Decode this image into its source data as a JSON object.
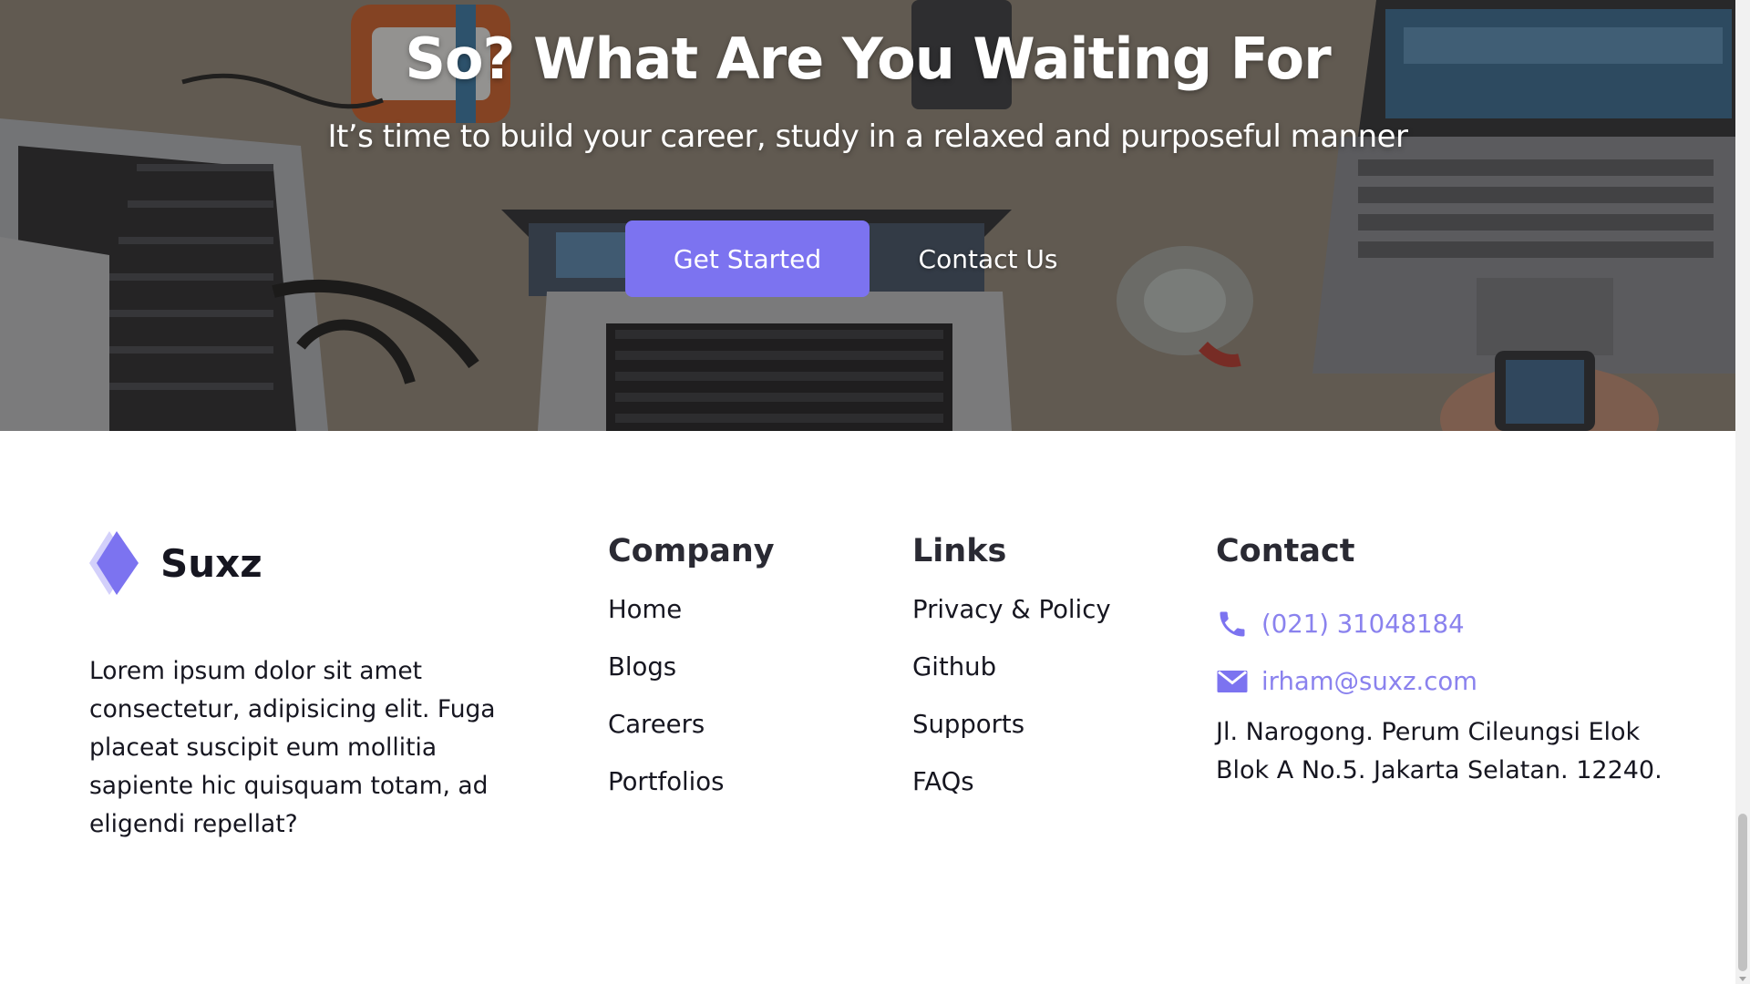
{
  "hero": {
    "title": "So? What Are You Waiting For",
    "subtitle": "It’s time to build your career, study in a relaxed and purposeful manner",
    "primary_button": "Get Started",
    "secondary_button": "Contact Us",
    "background_description_icon": "workspace-laptops-photo"
  },
  "footer": {
    "brand": {
      "name": "Suxz",
      "logo_icon": "diamond-logo-icon"
    },
    "about": "Lorem ipsum dolor sit amet consectetur, adipisicing elit. Fuga placeat suscipit eum mollitia sapiente hic quisquam totam, ad eligendi repellat?",
    "company": {
      "heading": "Company",
      "items": [
        "Home",
        "Blogs",
        "Careers",
        "Portfolios"
      ]
    },
    "links": {
      "heading": "Links",
      "items": [
        "Privacy & Policy",
        "Github",
        "Supports",
        "FAQs"
      ]
    },
    "contact": {
      "heading": "Contact",
      "phone": "(021) 31048184",
      "phone_icon": "phone-icon",
      "email": "irham@suxz.com",
      "email_icon": "mail-icon",
      "address": "Jl. Narogong. Perum Cileungsi Elok Blok A No.5. Jakarta Selatan. 12240."
    }
  },
  "colors": {
    "accent": "#7c73f0",
    "accent_light": "#8a82ee",
    "text_dark": "#161620"
  }
}
